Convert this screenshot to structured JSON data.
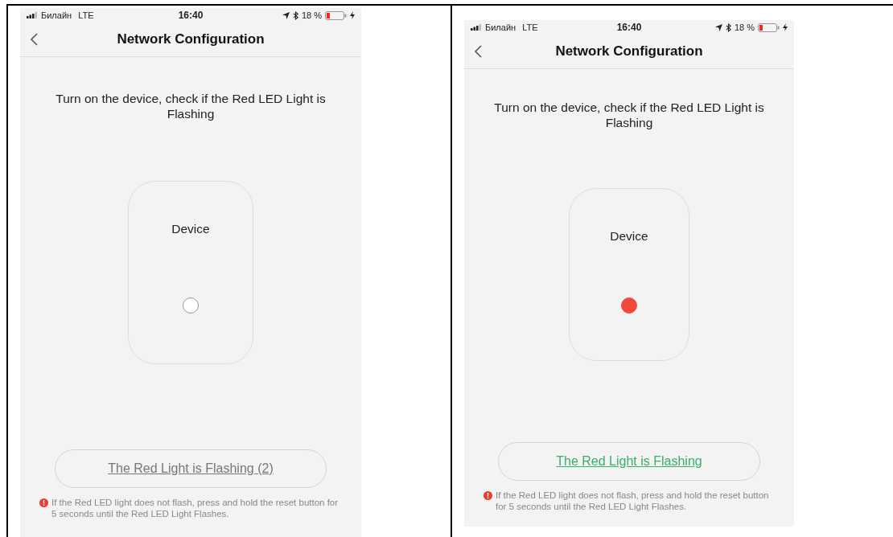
{
  "screens": [
    {
      "status_bar": {
        "carrier": "Билайн",
        "network": "LTE",
        "time": "16:40",
        "battery": "18 %"
      },
      "title": "Network Configuration",
      "instruction": "Turn on the device, check if the Red LED Light is Flashing",
      "device_label": "Device",
      "led_on": false,
      "button": {
        "label": "The Red Light is Flashing (2)",
        "active": false
      },
      "hint": "If the Red LED light does not flash, press and hold the reset button for 5 seconds until the Red LED Light Flashes."
    },
    {
      "status_bar": {
        "carrier": "Билайн",
        "network": "LTE",
        "time": "16:40",
        "battery": "18 %"
      },
      "title": "Network Configuration",
      "instruction": "Turn on the device, check if the Red LED Light is Flashing",
      "device_label": "Device",
      "led_on": true,
      "button": {
        "label": "The Red Light is Flashing",
        "active": true
      },
      "hint": "If the Red LED light does not flash, press and hold the reset button for 5 seconds until the Red LED Light Flashes."
    }
  ]
}
